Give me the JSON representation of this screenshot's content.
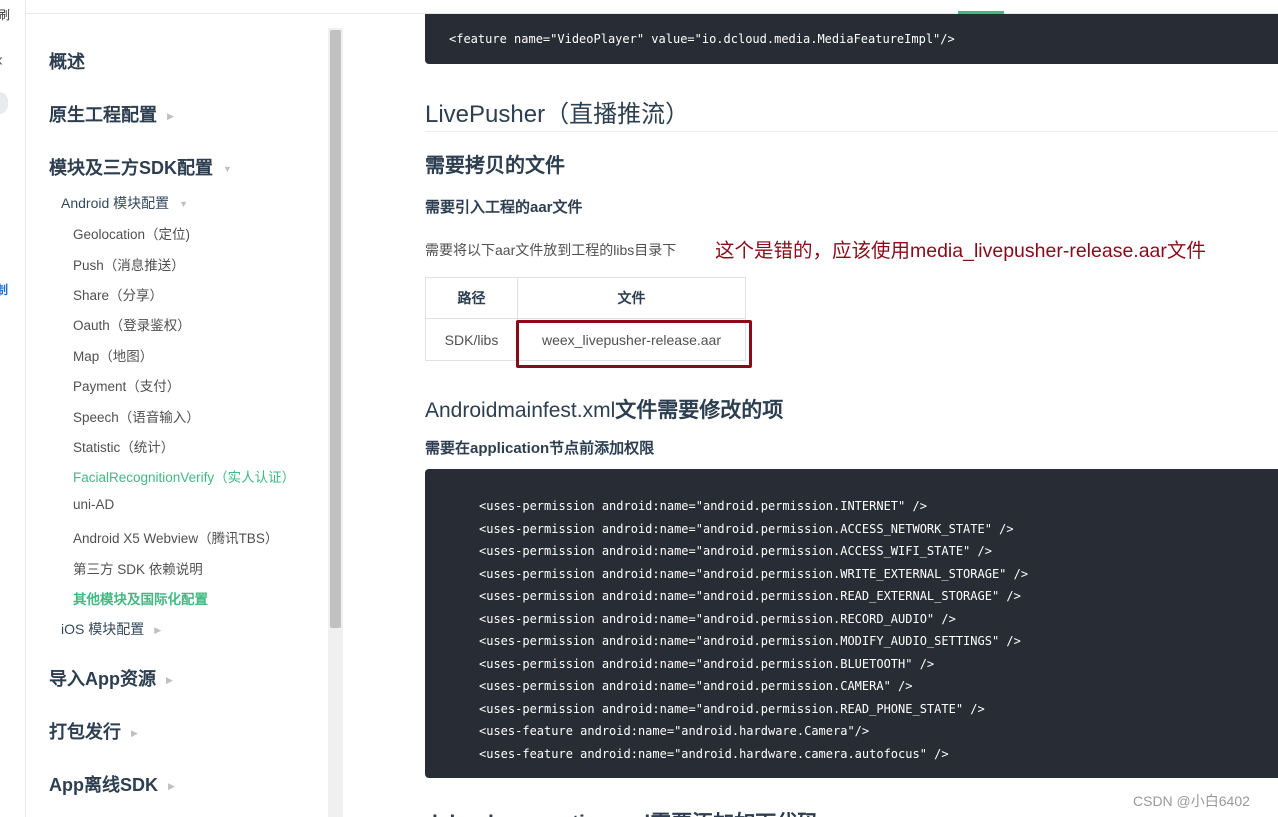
{
  "left_strip": {
    "top_text": "刷",
    "link_text": "制",
    "chevron": "‹"
  },
  "sidebar": {
    "items": [
      {
        "label": "概述",
        "level": 1,
        "caret": false
      },
      {
        "label": "原生工程配置",
        "level": 1,
        "caret": "right"
      },
      {
        "label": "模块及三方SDK配置",
        "level": 1,
        "caret": "down"
      },
      {
        "label": "Android 模块配置",
        "level": 2,
        "caret": "down"
      },
      {
        "label": "Geolocation（定位)",
        "level": 3
      },
      {
        "label": "Push（消息推送）",
        "level": 3
      },
      {
        "label": "Share（分享）",
        "level": 3
      },
      {
        "label": "Oauth（登录鉴权）",
        "level": 3
      },
      {
        "label": "Map（地图）",
        "level": 3
      },
      {
        "label": "Payment（支付）",
        "level": 3
      },
      {
        "label": "Speech（语音输入）",
        "level": 3
      },
      {
        "label": "Statistic（统计）",
        "level": 3
      },
      {
        "label": "FacialRecognitionVerify（实人认证）",
        "level": 3,
        "active": true
      },
      {
        "label": "uni-AD",
        "level": 3
      },
      {
        "label": "Android X5 Webview（腾讯TBS）",
        "level": 3
      },
      {
        "label": "第三方 SDK 依赖说明",
        "level": 3
      },
      {
        "label": "其他模块及国际化配置",
        "level": 3,
        "current": true
      },
      {
        "label": "iOS 模块配置",
        "level": 2,
        "caret": "right"
      },
      {
        "label": "导入App资源",
        "level": 1,
        "caret": "right"
      },
      {
        "label": "打包发行",
        "level": 1,
        "caret": "right"
      },
      {
        "label": "App离线SDK",
        "level": 1,
        "caret": "right"
      }
    ]
  },
  "main": {
    "code_top": "<feature name=\"VideoPlayer\" value=\"io.dcloud.media.MediaFeatureImpl\"/>",
    "heading_live": "LivePusher（直播推流）",
    "heading_files": "需要拷贝的文件",
    "heading_aar": "需要引入工程的aar文件",
    "para_put": "需要将以下aar文件放到工程的libs目录下",
    "annotation_red": "这个是错的，应该使用media_livepusher-release.aar文件",
    "table": {
      "headers": [
        "路径",
        "文件"
      ],
      "rows": [
        [
          "SDK/libs",
          "weex_livepusher-release.aar"
        ]
      ]
    },
    "heading_manifest_prefix": "Androidmainfest.xml",
    "heading_manifest_suffix": "文件需要修改的项",
    "heading_perm": "需要在application节点前添加权限",
    "code_lines": [
      "<uses-permission android:name=\"android.permission.INTERNET\" />",
      "<uses-permission android:name=\"android.permission.ACCESS_NETWORK_STATE\" />",
      "<uses-permission android:name=\"android.permission.ACCESS_WIFI_STATE\" />",
      "<uses-permission android:name=\"android.permission.WRITE_EXTERNAL_STORAGE\" />",
      "<uses-permission android:name=\"android.permission.READ_EXTERNAL_STORAGE\" />",
      "<uses-permission android:name=\"android.permission.RECORD_AUDIO\" />",
      "<uses-permission android:name=\"android.permission.MODIFY_AUDIO_SETTINGS\" />",
      "<uses-permission android:name=\"android.permission.BLUETOOTH\" />",
      "<uses-permission android:name=\"android.permission.CAMERA\" />",
      "<uses-permission android:name=\"android.permission.READ_PHONE_STATE\" />",
      "<uses-feature android:name=\"android.hardware.Camera\"/>",
      "<uses-feature android:name=\"android.hardware.camera.autofocus\" />"
    ],
    "heading_bottom": "dcloud_properties.xml需要添加如下代码"
  },
  "watermark": "CSDN @小白6402",
  "colors": {
    "accent": "#42b983",
    "code_bg": "#282c34",
    "annotation": "#8b0a1a"
  }
}
